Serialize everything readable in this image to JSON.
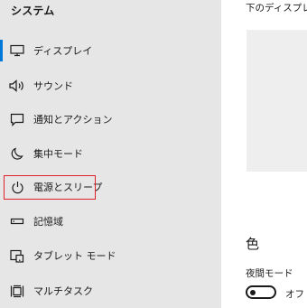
{
  "sidebar": {
    "title": "システム",
    "items": [
      {
        "label": "ディスプレイ",
        "icon": "monitor-icon",
        "active": true
      },
      {
        "label": "サウンド",
        "icon": "speaker-icon"
      },
      {
        "label": "通知とアクション",
        "icon": "notification-icon"
      },
      {
        "label": "集中モード",
        "icon": "moon-icon"
      },
      {
        "label": "電源とスリープ",
        "icon": "power-icon",
        "highlighted": true
      },
      {
        "label": "記憶域",
        "icon": "storage-icon"
      },
      {
        "label": "タブレット モード",
        "icon": "tablet-icon"
      },
      {
        "label": "マルチタスク",
        "icon": "multitask-icon"
      }
    ]
  },
  "content": {
    "top_text": "下のディスプレイ",
    "color_heading": "色",
    "night_mode": {
      "label": "夜間モード",
      "state": "オフ",
      "on": false
    }
  },
  "colors": {
    "accent": "#0078d7",
    "highlight_border": "#e0202a",
    "sidebar_bg": "#e6e6e6",
    "preview_bg": "#eeeeee"
  }
}
